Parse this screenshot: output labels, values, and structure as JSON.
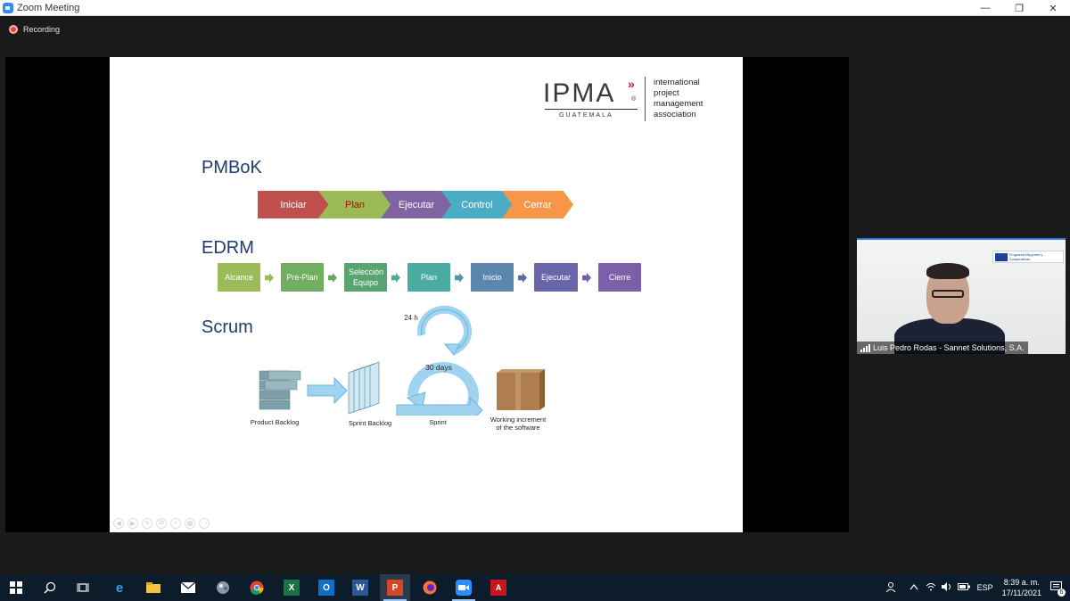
{
  "window": {
    "title": "Zoom Meeting",
    "controls": [
      "—",
      "❐",
      "✕"
    ]
  },
  "meeting": {
    "recording_label": "Recording"
  },
  "slide": {
    "logo": {
      "wordmark": "IPMA",
      "chevrons": "»",
      "registered": "®",
      "country": "GUATEMALA",
      "tagline_lines": [
        "international",
        "project",
        "management",
        "association"
      ]
    },
    "pmbok": {
      "title": "PMBoK",
      "steps": [
        {
          "label": "Iniciar",
          "color": "#c0504d",
          "text_color": "#ffffff"
        },
        {
          "label": "Plan",
          "color": "#9bbb59",
          "text_color": "#c00000"
        },
        {
          "label": "Ejecutar",
          "color": "#8064a2",
          "text_color": "#ffffff"
        },
        {
          "label": "Control",
          "color": "#4bacc6",
          "text_color": "#ffffff"
        },
        {
          "label": "Cerrar",
          "color": "#f79646",
          "text_color": "#ffffff"
        }
      ]
    },
    "edrm": {
      "title": "EDRM",
      "steps": [
        {
          "label": "Alcance",
          "color": "#9bbb59"
        },
        {
          "label": "Pre-Plan",
          "color": "#71ae5f"
        },
        {
          "label": "Selección Equipo",
          "color": "#5aa472"
        },
        {
          "label": "Plan",
          "color": "#4aaca1"
        },
        {
          "label": "Inicio",
          "color": "#5b87ae"
        },
        {
          "label": "Ejecutar",
          "color": "#6a65a8"
        },
        {
          "label": "Cierre",
          "color": "#7c5fa8"
        }
      ],
      "arrow_colors": [
        "#9bbb59",
        "#66a85c",
        "#4fa893",
        "#5094ae",
        "#636aaa",
        "#7360a8"
      ]
    },
    "scrum": {
      "title": "Scrum",
      "cycle_daily": "24 h",
      "cycle_sprint": "30 days",
      "labels": {
        "product_backlog": "Product Backlog",
        "sprint_backlog": "Sprint Backlog",
        "sprint": "Sprint",
        "increment_line1": "Working increment",
        "increment_line2": "of the software"
      }
    },
    "nav_icons": [
      "◀",
      "▶",
      "✎",
      "⧉",
      "⌕",
      "▦",
      "⋯"
    ]
  },
  "participant": {
    "name": "Luis Pedro Rodas - Sannet Solutions, S.A.",
    "banner_text": "Programa Mipymes y Cooperativas"
  },
  "taskbar": {
    "apps": [
      "windows",
      "search",
      "task-view",
      "edge",
      "file-explorer",
      "mail",
      "paint-3d",
      "chrome",
      "excel",
      "outlook",
      "word",
      "powerpoint",
      "firefox",
      "zoom",
      "acrobat"
    ],
    "language": "ESP",
    "time": "8:39 a. m.",
    "date": "17/11/2021",
    "notifications": "6"
  }
}
